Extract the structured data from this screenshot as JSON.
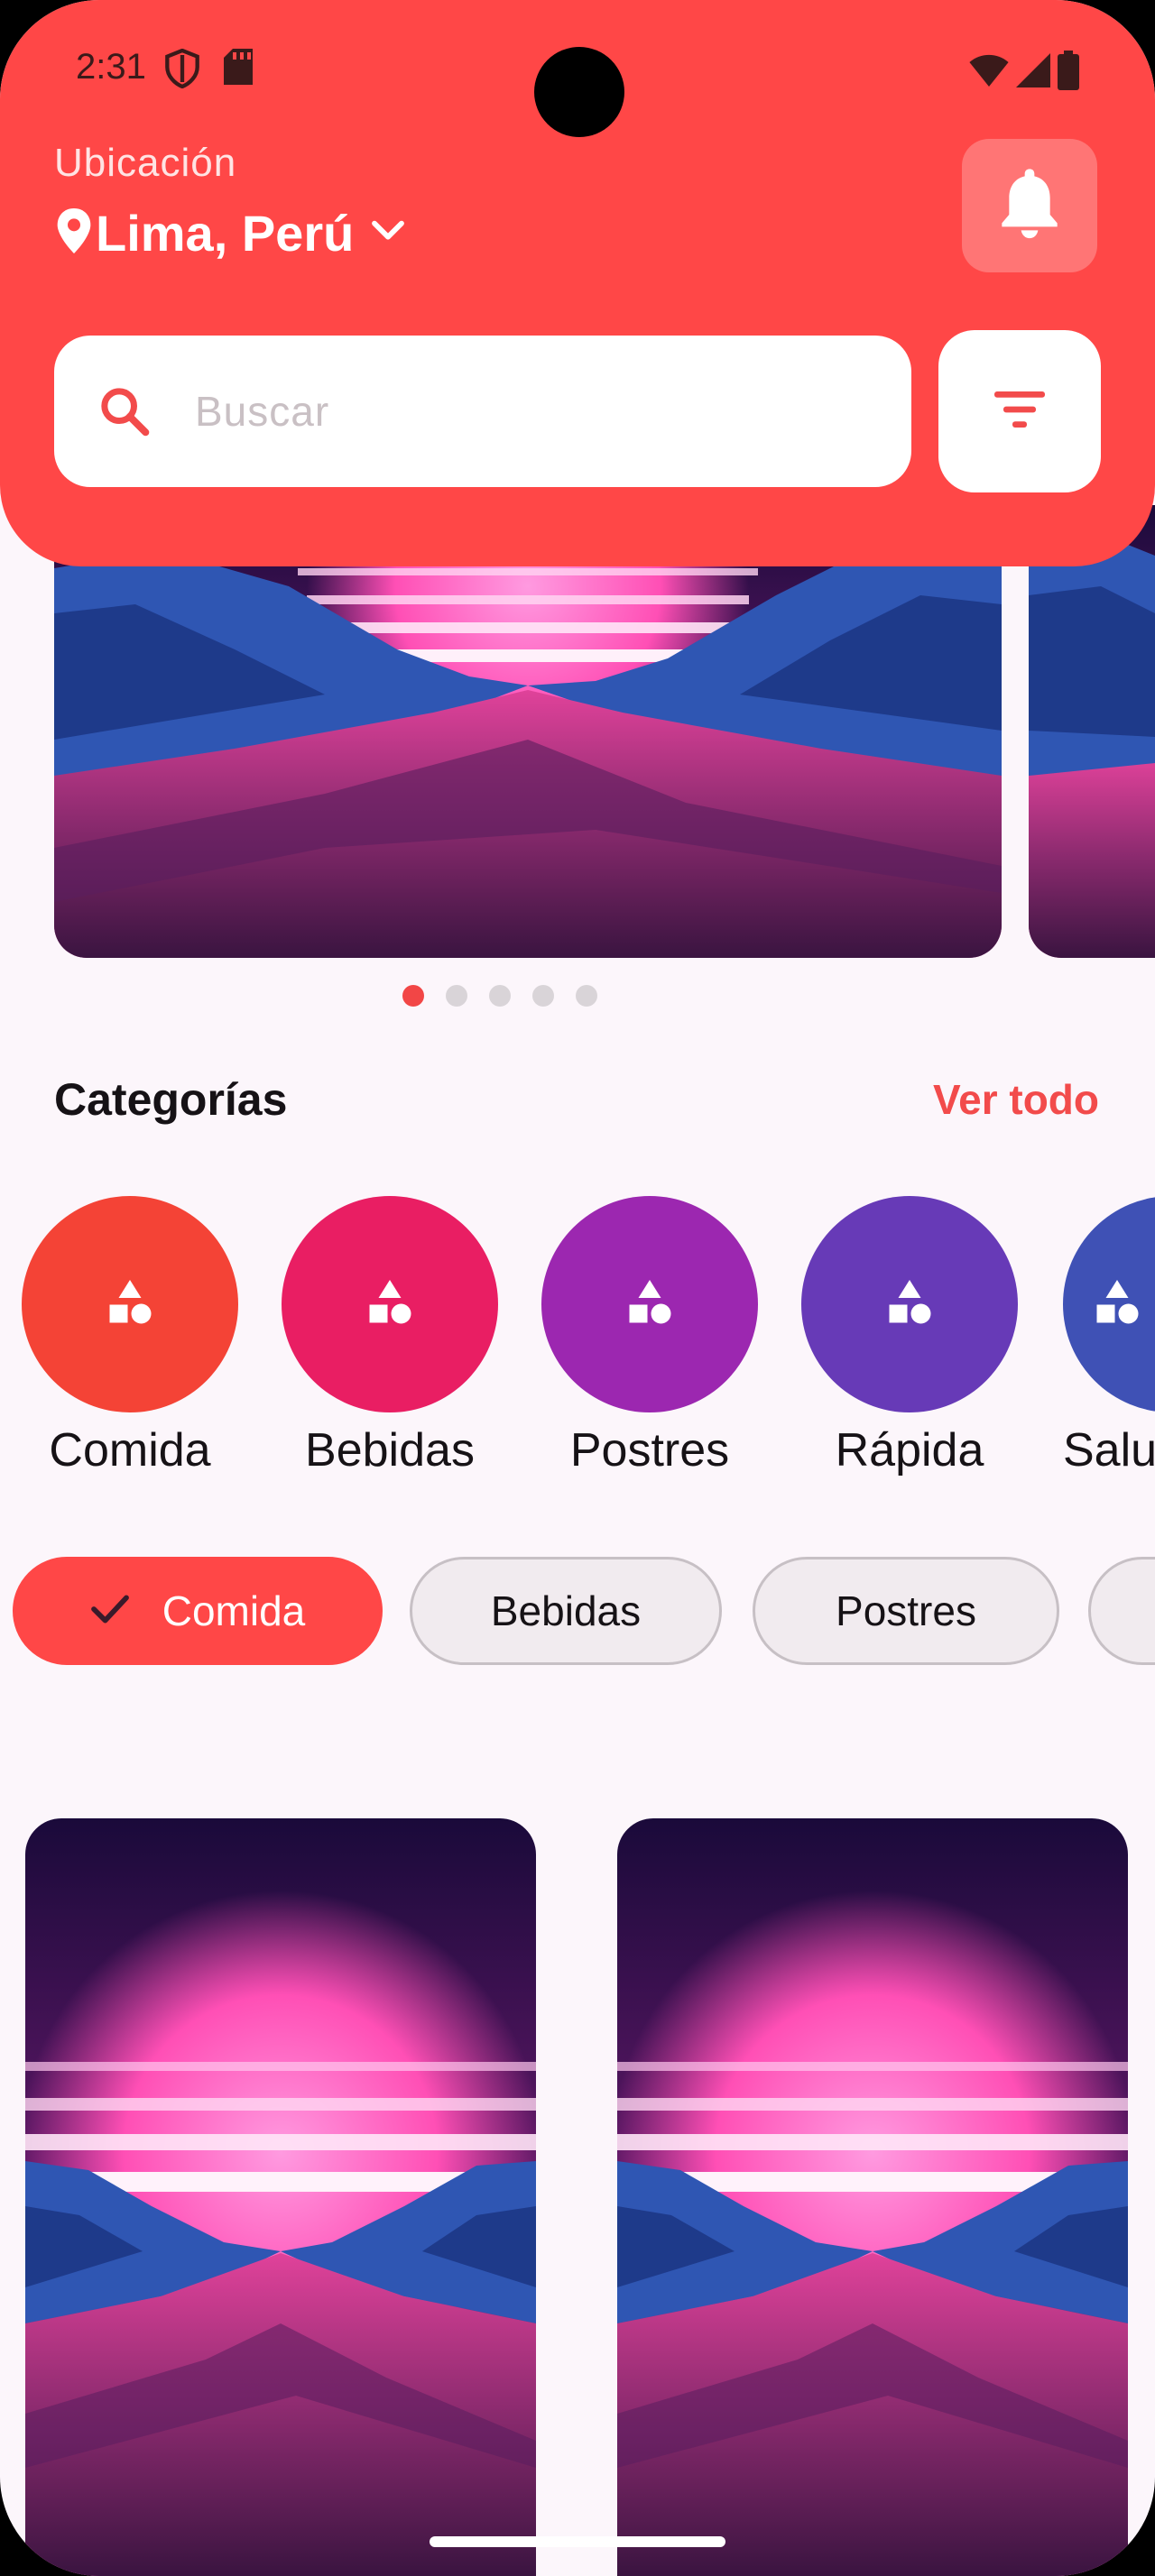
{
  "status_bar": {
    "time": "2:31"
  },
  "header": {
    "location_caption": "Ubicación",
    "location_value": "Lima, Perú",
    "search_placeholder": "Buscar"
  },
  "carousel": {
    "dot_count": 5,
    "active_index": 0
  },
  "categories_section": {
    "title": "Categorías",
    "see_all": "Ver todo",
    "items": [
      {
        "label": "Comida",
        "color": "#F44336"
      },
      {
        "label": "Bebidas",
        "color": "#E91E63"
      },
      {
        "label": "Postres",
        "color": "#9C27B0"
      },
      {
        "label": "Rápida",
        "color": "#673AB7"
      },
      {
        "label": "Salu",
        "color": "#3F51B5"
      }
    ]
  },
  "filter_chips": [
    {
      "label": "Comida",
      "selected": true
    },
    {
      "label": "Bebidas",
      "selected": false
    },
    {
      "label": "Postres",
      "selected": false
    }
  ],
  "colors": {
    "primary": "#FF4747",
    "background": "#FCF6FB"
  },
  "icons": [
    "shield-icon",
    "sd-card-icon",
    "wifi-icon",
    "signal-icon",
    "battery-icon",
    "location-pin-icon",
    "chevron-down-icon",
    "bell-icon",
    "search-icon",
    "filter-icon",
    "category-icon",
    "check-icon"
  ]
}
